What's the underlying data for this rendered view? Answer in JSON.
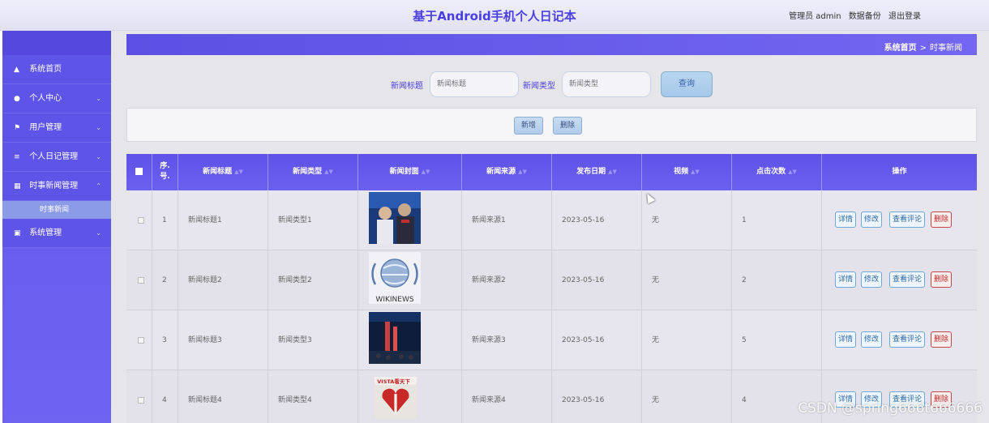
{
  "app": {
    "title": "基于Android手机个人日记本",
    "user_label": "管理员 admin",
    "backup_link": "数据备份",
    "logout_link": "退出登录"
  },
  "sidebar": {
    "items": [
      {
        "label": "系统首页",
        "icon": "home-icon"
      },
      {
        "label": "个人中心",
        "icon": "user-icon"
      },
      {
        "label": "用户管理",
        "icon": "flag-icon"
      },
      {
        "label": "个人日记管理",
        "icon": "sliders-icon"
      },
      {
        "label": "时事新闻管理",
        "icon": "grid-icon"
      },
      {
        "label": "系统管理",
        "icon": "briefcase-icon"
      }
    ],
    "sub_item": "时事新闻"
  },
  "breadcrumb": {
    "home": "系统首页",
    "separator": ">",
    "current": "时事新闻"
  },
  "search": {
    "title_label": "新闻标题",
    "title_placeholder": "新闻标题",
    "type_label": "新闻类型",
    "type_placeholder": "新闻类型",
    "query_button": "查询"
  },
  "actions": {
    "add_button": "新增",
    "delete_button": "删除"
  },
  "table": {
    "columns": [
      "序号",
      "新闻标题",
      "新闻类型",
      "新闻封面",
      "新闻来源",
      "发布日期",
      "视频",
      "点击次数",
      "操作"
    ],
    "index_header_line1": "序.",
    "index_header_line2": "号.",
    "rows": [
      {
        "index": "1",
        "title": "新闻标题1",
        "type": "新闻类型1",
        "source": "新闻来源1",
        "date": "2023-05-16",
        "video": "无",
        "clicks": "1"
      },
      {
        "index": "2",
        "title": "新闻标题2",
        "type": "新闻类型2",
        "source": "新闻来源2",
        "date": "2023-05-16",
        "video": "无",
        "clicks": "2"
      },
      {
        "index": "3",
        "title": "新闻标题3",
        "type": "新闻类型3",
        "source": "新闻来源3",
        "date": "2023-05-16",
        "video": "无",
        "clicks": "5"
      },
      {
        "index": "4",
        "title": "新闻标题4",
        "type": "新闻类型4",
        "source": "新闻来源4",
        "date": "2023-05-16",
        "video": "无",
        "clicks": "4"
      }
    ],
    "row_actions": {
      "detail": "详情",
      "edit": "修改",
      "comments": "查看评论",
      "delete": "删除"
    },
    "cover_caption_row2": "WIKINEWS",
    "cover_caption_row4": "VISTA看天下"
  },
  "watermark": "CSDN @spring666t666666",
  "colors": {
    "accent": "#5e52e8",
    "title": "#4b3ee0",
    "delete": "#c02a2a"
  }
}
